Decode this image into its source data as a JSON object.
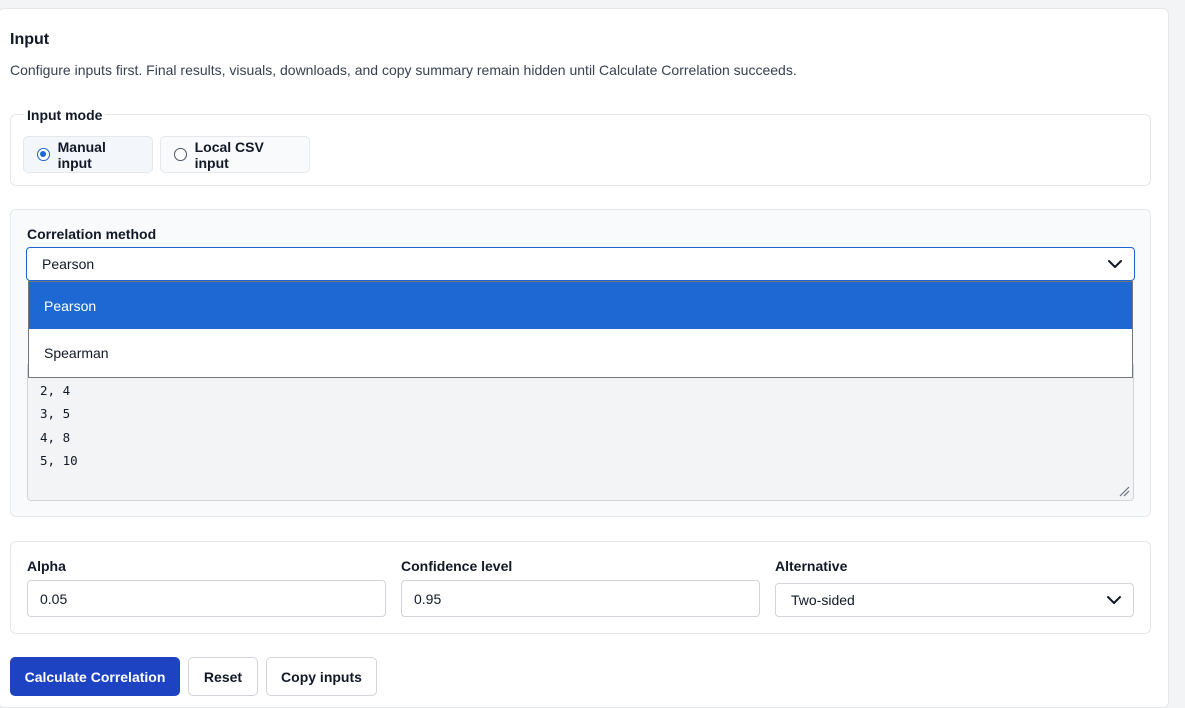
{
  "section": {
    "title": "Input",
    "description": "Configure inputs first. Final results, visuals, downloads, and copy summary remain hidden until Calculate Correlation succeeds."
  },
  "input_mode": {
    "legend": "Input mode",
    "options": [
      {
        "label": "Manual input",
        "checked": true
      },
      {
        "label": "Local CSV input",
        "checked": false
      }
    ]
  },
  "method": {
    "label": "Correlation method",
    "value": "Pearson",
    "options": [
      "Pearson",
      "Spearman"
    ]
  },
  "data_text": {
    "lines": [
      "2, 4",
      "3, 5",
      "4, 8",
      "5, 10"
    ]
  },
  "params": {
    "alpha_label": "Alpha",
    "alpha_value": "0.05",
    "confidence_label": "Confidence level",
    "confidence_value": "0.95",
    "alternative_label": "Alternative",
    "alternative_value": "Two-sided"
  },
  "buttons": {
    "calculate": "Calculate Correlation",
    "reset": "Reset",
    "copy": "Copy inputs"
  },
  "colors": {
    "primary": "#1d43c2",
    "highlight": "#1e68d4",
    "focus": "#1d64d6"
  }
}
